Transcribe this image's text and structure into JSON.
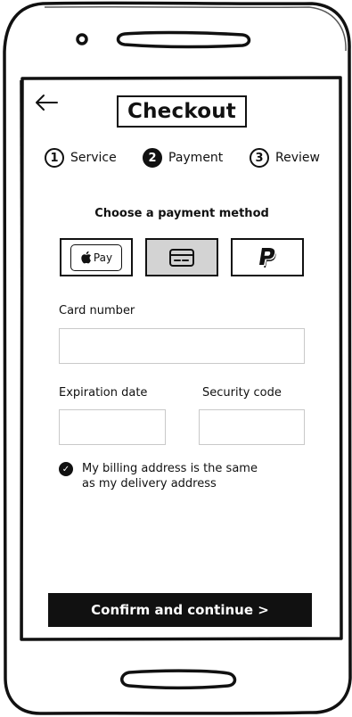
{
  "header": {
    "title": "Checkout"
  },
  "steps": [
    {
      "number": "1",
      "label": "Service",
      "state": "done"
    },
    {
      "number": "2",
      "label": "Payment",
      "state": "active"
    },
    {
      "number": "3",
      "label": "Review",
      "state": "upcoming"
    }
  ],
  "payment": {
    "heading": "Choose a payment method",
    "methods": [
      {
        "id": "apple-pay",
        "label": "Pay",
        "icon": "apple-icon",
        "selected": false
      },
      {
        "id": "card",
        "label": "",
        "icon": "credit-card-icon",
        "selected": true
      },
      {
        "id": "paypal",
        "label": "",
        "icon": "paypal-icon",
        "selected": false
      }
    ]
  },
  "form": {
    "card_number_label": "Card number",
    "card_number_value": "",
    "expiration_label": "Expiration date",
    "expiration_value": "",
    "security_label": "Security code",
    "security_value": ""
  },
  "billing": {
    "checked": true,
    "text": "My billing address is the same as my delivery address"
  },
  "actions": {
    "confirm_label": "Confirm and continue >"
  },
  "colors": {
    "ink": "#111111",
    "selected_fill": "#d3d3d3",
    "field_border": "#c9c9c9",
    "background": "#ffffff"
  }
}
